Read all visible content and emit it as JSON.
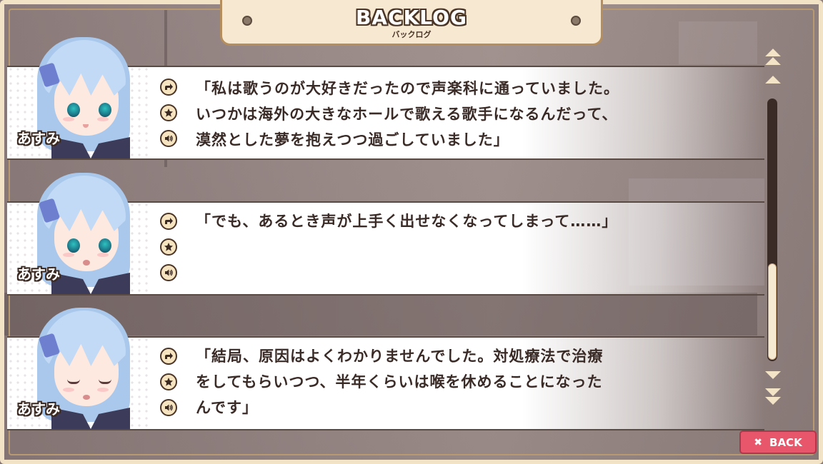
{
  "title": {
    "main": "BACKLOG",
    "sub": "バックログ"
  },
  "entries": [
    {
      "speaker": "あすみ",
      "expression": "smile",
      "lines": [
        "「私は歌うのが大好きだったので声楽科に通っていました。",
        "いつかは海外の大きなホールで歌える歌手になるんだって、",
        "漠然とした夢を抱えつつ過ごしていました」"
      ]
    },
    {
      "speaker": "あすみ",
      "expression": "worried",
      "lines": [
        "「でも、あるとき声が上手く出せなくなってしまって……」"
      ]
    },
    {
      "speaker": "あすみ",
      "expression": "eyes-closed",
      "lines": [
        "「結局、原因はよくわかりませんでした。対処療法で治療",
        "をしてもらいつつ、半年くらいは喉を休めることになった",
        "んです」"
      ]
    }
  ],
  "icons": {
    "jump": "jump-arrow-icon",
    "favorite": "star-icon",
    "voice": "voice-replay-icon"
  },
  "scroll": {
    "position_fraction": 1.0,
    "visible_fraction": 0.37
  },
  "back_button": {
    "label": "BACK",
    "icon": "close-x-icon"
  },
  "colors": {
    "back_button": "#e8566b",
    "frame": "#f2e2c6",
    "track": "#3a2b27"
  }
}
